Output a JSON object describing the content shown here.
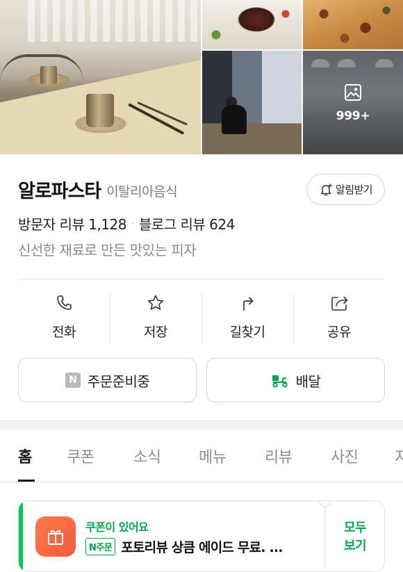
{
  "gallery": {
    "more_count": "999+",
    "more_icon": "image-icon"
  },
  "place": {
    "name": "알로파스타",
    "category": "이탈리아음식",
    "notify_label": "알림받기",
    "visitor_review": "방문자 리뷰 1,128",
    "blog_review": "블로그 리뷰 624",
    "separator": "·",
    "description": "신선한 재료로 만든 맛있는 피자"
  },
  "actions": [
    {
      "label": "전화",
      "icon": "phone-icon"
    },
    {
      "label": "저장",
      "icon": "star-icon"
    },
    {
      "label": "길찾기",
      "icon": "directions-icon"
    },
    {
      "label": "공유",
      "icon": "share-icon"
    }
  ],
  "buttons": {
    "order_badge": "N",
    "order_label": "주문준비중",
    "delivery_label": "배달"
  },
  "tabs": [
    "홈",
    "쿠폰",
    "소식",
    "메뉴",
    "리뷰",
    "사진",
    "지"
  ],
  "active_tab": 0,
  "coupon": {
    "title": "쿠폰이 있어요",
    "badge": "N주문",
    "text": "포토리뷰 상큼 에이드 무료. ...",
    "see_all_line1": "모두",
    "see_all_line2": "보기"
  },
  "colors": {
    "accent_green": "#03a84e",
    "brand_green": "#03c75a",
    "coupon_gift": "#f45a3c"
  }
}
